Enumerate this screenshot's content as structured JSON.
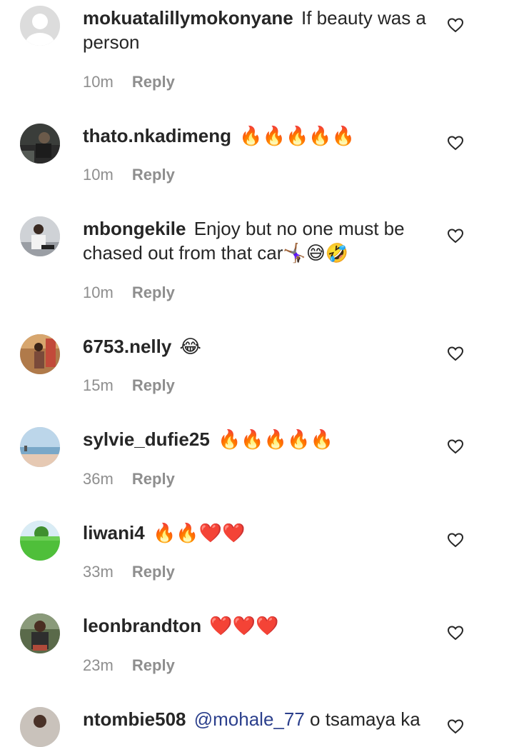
{
  "reply_label": "Reply",
  "comments": [
    {
      "username": "mokuatalillymokonyane",
      "text": "If beauty was a person",
      "time": "10m",
      "avatar": "default-avatar"
    },
    {
      "username": "thato.nkadimeng",
      "text": "🔥🔥🔥🔥🔥",
      "time": "10m",
      "avatar": "dark-photo"
    },
    {
      "username": "mbongekile",
      "text": "Enjoy but no one must be chased out from that car🤸🏾‍♀️😅🤣",
      "time": "10m",
      "avatar": "person-photo"
    },
    {
      "username": "6753.nelly",
      "text": "😂",
      "time": "15m",
      "avatar": "orange-photo"
    },
    {
      "username": "sylvie_dufie25",
      "text": "🔥🔥🔥🔥🔥",
      "time": "36m",
      "avatar": "beach-photo"
    },
    {
      "username": "liwani4",
      "text": "🔥🔥❤️❤️",
      "time": "33m",
      "avatar": "green-photo"
    },
    {
      "username": "leonbrandton",
      "text": "❤️❤️❤️",
      "time": "23m",
      "avatar": "person-photo"
    },
    {
      "username": "ntombie508",
      "mention": "@mohale_77",
      "text": " o tsamaya ka",
      "avatar": "person-photo"
    }
  ],
  "colors": {
    "text": "#262626",
    "meta": "#8e8e8e",
    "mention": "#2b3f8c"
  }
}
